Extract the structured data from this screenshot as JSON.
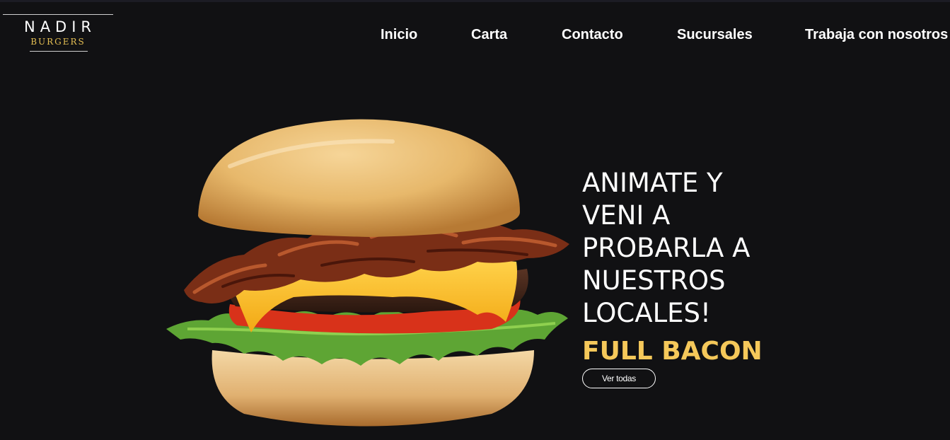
{
  "logo": {
    "brand": "NADIR",
    "sub": "BURGERS"
  },
  "nav": {
    "items": [
      {
        "label": "Inicio"
      },
      {
        "label": "Carta"
      },
      {
        "label": "Contacto"
      },
      {
        "label": "Sucursales"
      },
      {
        "label": "Trabaja con nosotros"
      }
    ]
  },
  "hero": {
    "headline_lines": [
      "ANIMATE Y",
      "VENI A",
      "PROBARLA A",
      "NUESTROS",
      "LOCALES!"
    ],
    "product_name": "FULL BACON",
    "cta_label": "Ver todas",
    "image_icon": "burger-image"
  },
  "colors": {
    "background": "#111113",
    "accent": "#f5c85a",
    "text": "#ffffff"
  }
}
